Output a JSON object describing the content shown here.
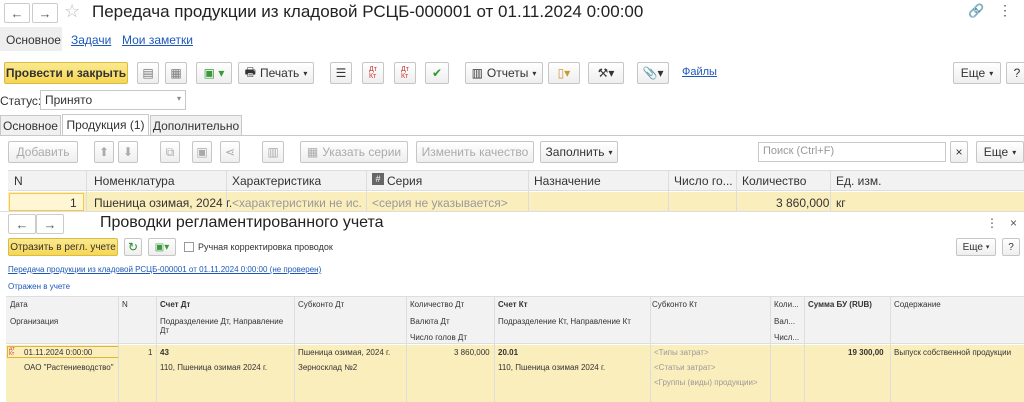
{
  "window": {
    "title": "Передача продукции из кладовой РСЦБ-000001 от 01.11.2024 0:00:00"
  },
  "nav_tabs": [
    "Основное",
    "Задачи",
    "Мои заметки"
  ],
  "toolbar": {
    "post_close": "Провести и закрыть",
    "print": "Печать",
    "reports": "Отчеты",
    "files": "Файлы",
    "more": "Еще",
    "help": "?"
  },
  "status": {
    "label": "Статус:",
    "value": "Принято"
  },
  "form_tabs": [
    "Основное",
    "Продукция (1)",
    "Дополнительно"
  ],
  "products_toolbar": {
    "add": "Добавить",
    "specify_series": "Указать серии",
    "change_quality": "Изменить качество",
    "fill": "Заполнить",
    "search_placeholder": "Поиск (Ctrl+F)",
    "more": "Еще"
  },
  "products_table": {
    "headers": [
      "N",
      "Номенклатура",
      "Характеристика",
      "Серия",
      "Назначение",
      "Число го...",
      "Количество",
      "Ед. изм."
    ],
    "row": {
      "n": "1",
      "item": "Пшеница озимая, 2024 г.",
      "characteristic": "<характеристики не ис...",
      "series": "<серия не указывается>",
      "quantity": "3 860,000",
      "unit": "кг"
    }
  },
  "sub": {
    "title": "Проводки регламентированного учета",
    "reflect_btn": "Отразить в регл. учете",
    "manual_label": "Ручная корректировка проводок",
    "more": "Еще",
    "help": "?",
    "doc_link": "Передача продукции из кладовой РСЦБ-000001 от 01.11.2024 0:00:00 (не проверен)",
    "reflected": "Отражен в учете",
    "headers": {
      "date": "Дата",
      "n": "N",
      "dt": "Счет Дт",
      "sub_dt": "Субконто Дт",
      "qty_dt": "Количество Дт",
      "kt": "Счет Кт",
      "sub_kt": "Субконто Кт",
      "qty_kt": "Коли...",
      "sum": "Сумма БУ (RUB)",
      "content": "Содержание",
      "org": "Организация",
      "dept_dt": "Подразделение Дт, Направление Дт",
      "cur_dt": "Валюта Дт",
      "heads_dt": "Число голов Дт",
      "dept_kt": "Подразделение Кт, Направление Кт",
      "cur_kt": "Вал...",
      "heads_kt": "Числ..."
    },
    "row": {
      "date": "01.11.2024 0:00:00",
      "n": "1",
      "dt": "43",
      "sub_dt1": "Пшеница озимая, 2024 г.",
      "qty_dt": "3 860,000",
      "kt": "20.01",
      "sub_kt1": "<Типы затрат>",
      "sum": "19 300,00",
      "content": "Выпуск собственной продукции",
      "org": "ОАО \"Растениеводство\"",
      "dept_dt": "110, Пшеница озимая 2024 г.",
      "sub_dt2": "Зерносклад №2",
      "dept_kt": "110, Пшеница озимая 2024 г.",
      "sub_kt2": "<Статьи затрат>",
      "sub_kt3": "<Группы (виды) продукции>"
    }
  }
}
